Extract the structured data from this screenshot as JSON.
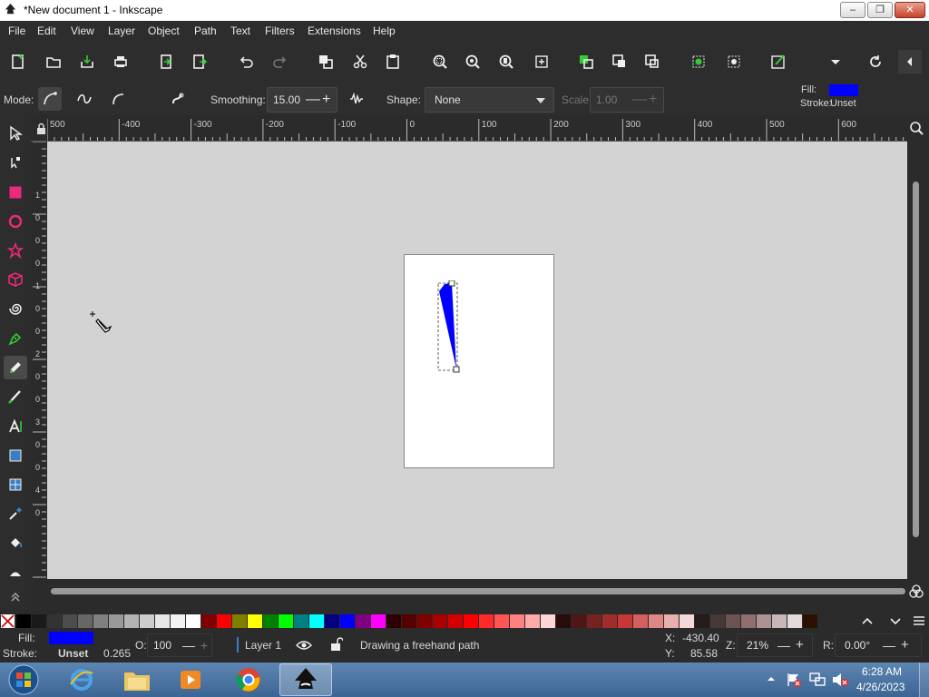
{
  "window": {
    "title": "*New document 1 - Inkscape",
    "min": "–",
    "max": "❐",
    "close": "✕"
  },
  "menu": [
    "File",
    "Edit",
    "View",
    "Layer",
    "Object",
    "Path",
    "Text",
    "Filters",
    "Extensions",
    "Help"
  ],
  "toolctl": {
    "mode_label": "Mode:",
    "smoothing_label": "Smoothing:",
    "smoothing_value": "15.00",
    "shape_label": "Shape:",
    "shape_value": "None",
    "scale_label": "Scale:",
    "scale_value": "1.00",
    "fill_label": "Fill:",
    "stroke_label": "Stroke:",
    "stroke_value": "Unset",
    "fill_color": "#0000ff"
  },
  "ruler": {
    "h_labels": [
      "500",
      "-400",
      "-300",
      "-200",
      "-100",
      "0",
      "100",
      "200",
      "300",
      "400",
      "500",
      "600"
    ],
    "v_labels": [
      "1",
      "0",
      "0",
      "0",
      "1",
      "0",
      "0",
      "2",
      "0",
      "0",
      "3",
      "0",
      "0",
      "4",
      "0"
    ]
  },
  "status": {
    "fill_label": "Fill:",
    "stroke_label": "Stroke:",
    "stroke_value": "Unset",
    "stroke_width": "0.265",
    "opacity_label": "O:",
    "opacity_value": "100",
    "layer": "Layer 1",
    "message": "Drawing a freehand path",
    "x_label": "X:",
    "x_value": "-430.40",
    "y_label": "Y:",
    "y_value": "85.58",
    "zoom_label": "Z:",
    "zoom_value": "21%",
    "rot_label": "R:",
    "rot_value": "0.00°"
  },
  "palette": [
    "#000000",
    "#1a1a1a",
    "#333333",
    "#4d4d4d",
    "#666666",
    "#808080",
    "#999999",
    "#b3b3b3",
    "#cccccc",
    "#e6e6e6",
    "#f2f2f2",
    "#ffffff",
    "#800000",
    "#ff0000",
    "#808000",
    "#ffff00",
    "#008000",
    "#00ff00",
    "#008080",
    "#00ffff",
    "#000080",
    "#0000ff",
    "#800080",
    "#ff00ff",
    "#2b0000",
    "#550000",
    "#800000",
    "#aa0000",
    "#d40000",
    "#ff0000",
    "#ff2a2a",
    "#ff5555",
    "#ff8080",
    "#ffaaaa",
    "#ffd5d5",
    "#280b0b",
    "#501616",
    "#782121",
    "#a02c2c",
    "#c83737",
    "#d35f5f",
    "#de8787",
    "#e9afaf",
    "#f4d7d7",
    "#241c1c",
    "#483737",
    "#6c5353",
    "#916f6f",
    "#ac9393",
    "#c8b7b7",
    "#e3dbdb",
    "#2b1100"
  ],
  "taskbar": {
    "time": "6:28 AM",
    "date": "4/26/2023"
  }
}
